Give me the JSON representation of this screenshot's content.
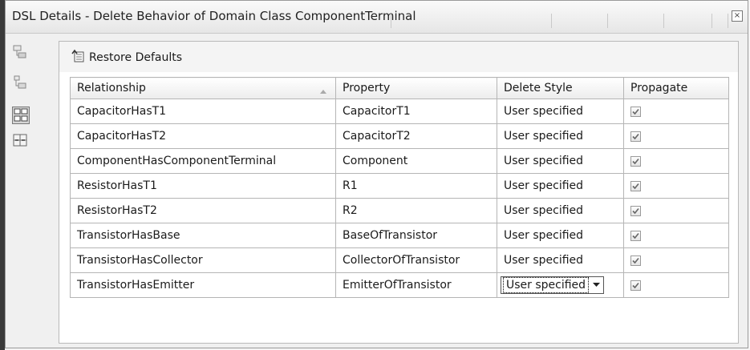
{
  "window": {
    "title": "DSL Details - Delete Behavior of Domain Class ComponentTerminal",
    "close_glyph": "×"
  },
  "sidebar": {
    "buttons": [
      {
        "name": "class-data-icon",
        "active": false
      },
      {
        "name": "element-data-icon",
        "active": false
      },
      {
        "name": "delete-behavior-icon",
        "active": true
      },
      {
        "name": "serialization-icon",
        "active": false
      }
    ]
  },
  "toolbar": {
    "restore_label": "Restore Defaults"
  },
  "table": {
    "headers": {
      "relationship": "Relationship",
      "property": "Property",
      "delete_style": "Delete Style",
      "propagate": "Propagate"
    },
    "rows": [
      {
        "relationship": "CapacitorHasT1",
        "property": "CapacitorT1",
        "delete_style": "User specified",
        "propagate": true
      },
      {
        "relationship": "CapacitorHasT2",
        "property": "CapacitorT2",
        "delete_style": "User specified",
        "propagate": true
      },
      {
        "relationship": "ComponentHasComponentTerminal",
        "property": "Component",
        "delete_style": "User specified",
        "propagate": true
      },
      {
        "relationship": "ResistorHasT1",
        "property": "R1",
        "delete_style": "User specified",
        "propagate": true
      },
      {
        "relationship": "ResistorHasT2",
        "property": "R2",
        "delete_style": "User specified",
        "propagate": true
      },
      {
        "relationship": "TransistorHasBase",
        "property": "BaseOfTransistor",
        "delete_style": "User specified",
        "propagate": true
      },
      {
        "relationship": "TransistorHasCollector",
        "property": "CollectorOfTransistor",
        "delete_style": "User specified",
        "propagate": true
      },
      {
        "relationship": "TransistorHasEmitter",
        "property": "EmitterOfTransistor",
        "delete_style": "User specified",
        "propagate": true
      }
    ],
    "editing_row_index": 7
  }
}
